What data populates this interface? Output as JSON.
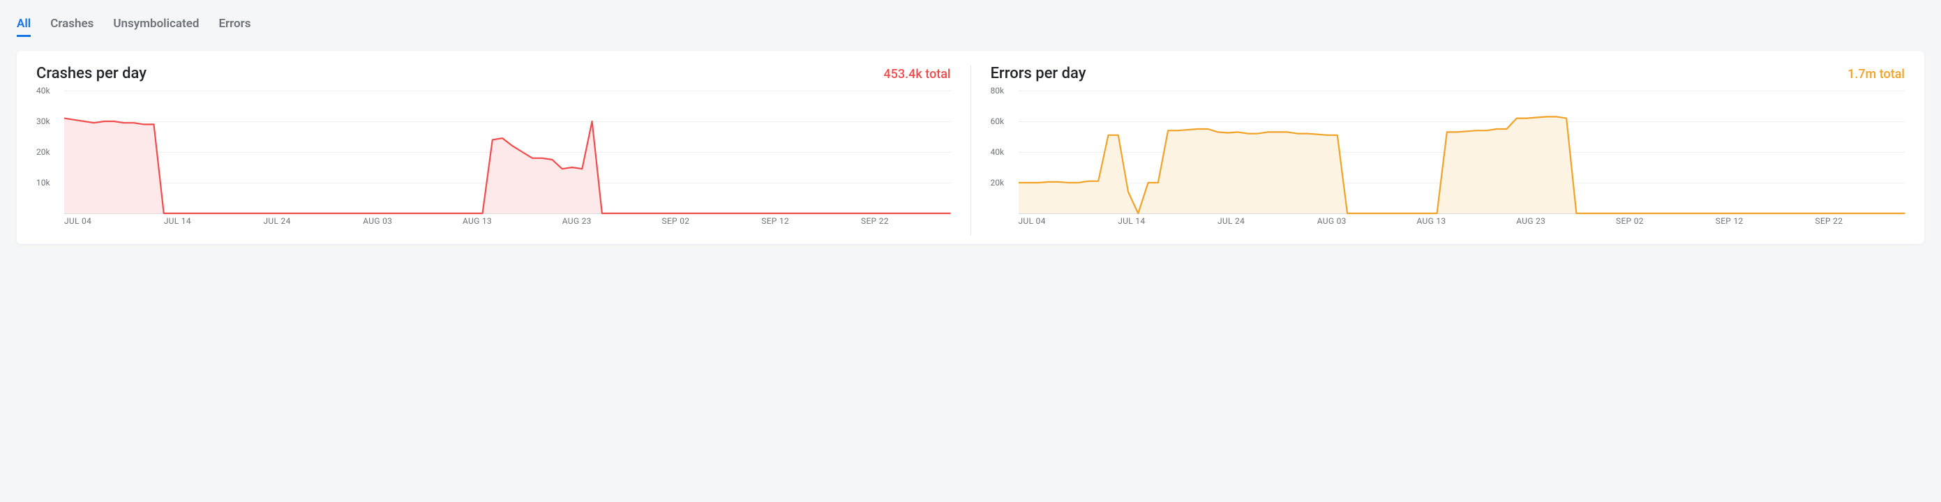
{
  "tabs": {
    "items": [
      {
        "label": "All",
        "active": true
      },
      {
        "label": "Crashes",
        "active": false
      },
      {
        "label": "Unsymbolicated",
        "active": false
      },
      {
        "label": "Errors",
        "active": false
      }
    ]
  },
  "panels": [
    {
      "id": "crashes",
      "title": "Crashes per day",
      "total_label": "453.4k total",
      "accent": "#f14c4c",
      "fill": "#fde9e9",
      "y_ticks": [
        {
          "label": "40k",
          "value": 40000
        },
        {
          "label": "30k",
          "value": 30000
        },
        {
          "label": "20k",
          "value": 20000
        },
        {
          "label": "10k",
          "value": 10000
        }
      ],
      "y_max": 40000,
      "x_ticks": [
        "JUL 04",
        "JUL 14",
        "JUL 24",
        "AUG 03",
        "AUG 13",
        "AUG 23",
        "SEP 02",
        "SEP 12",
        "SEP 22"
      ]
    },
    {
      "id": "errors",
      "title": "Errors per day",
      "total_label": "1.7m total",
      "accent": "#f0a229",
      "fill": "#fdf3e3",
      "y_ticks": [
        {
          "label": "80k",
          "value": 80000
        },
        {
          "label": "60k",
          "value": 60000
        },
        {
          "label": "40k",
          "value": 40000
        },
        {
          "label": "20k",
          "value": 20000
        }
      ],
      "y_max": 80000,
      "x_ticks": [
        "JUL 04",
        "JUL 14",
        "JUL 24",
        "AUG 03",
        "AUG 13",
        "AUG 23",
        "SEP 02",
        "SEP 12",
        "SEP 22"
      ]
    }
  ],
  "chart_data": [
    {
      "type": "area",
      "title": "Crashes per day",
      "xlabel": "",
      "ylabel": "",
      "ylim": [
        0,
        40000
      ],
      "x_tick_labels": [
        "JUL 04",
        "JUL 14",
        "JUL 24",
        "AUG 03",
        "AUG 13",
        "AUG 23",
        "SEP 02",
        "SEP 12",
        "SEP 22"
      ],
      "series": [
        {
          "name": "Crashes",
          "color": "#f14c4c",
          "x": [
            0,
            1,
            2,
            3,
            4,
            5,
            6,
            7,
            8,
            9,
            10,
            11,
            12,
            41,
            42,
            43,
            44,
            45,
            46,
            47,
            48,
            49,
            50,
            51,
            52,
            53,
            54,
            55,
            56,
            57,
            58,
            59,
            60,
            89
          ],
          "values": [
            31000,
            30500,
            30000,
            29500,
            30000,
            30000,
            29500,
            29500,
            29000,
            29000,
            0,
            0,
            0,
            0,
            0,
            24000,
            24500,
            22000,
            20000,
            18000,
            18000,
            17500,
            14500,
            15000,
            14500,
            30000,
            0,
            0,
            0,
            0,
            0,
            0,
            0,
            0
          ]
        }
      ],
      "x_range": [
        0,
        89
      ]
    },
    {
      "type": "area",
      "title": "Errors per day",
      "xlabel": "",
      "ylabel": "",
      "ylim": [
        0,
        80000
      ],
      "x_tick_labels": [
        "JUL 04",
        "JUL 14",
        "JUL 24",
        "AUG 03",
        "AUG 13",
        "AUG 23",
        "SEP 02",
        "SEP 12",
        "SEP 22"
      ],
      "series": [
        {
          "name": "Errors",
          "color": "#f0a229",
          "x": [
            0,
            1,
            2,
            3,
            4,
            5,
            6,
            7,
            8,
            9,
            10,
            11,
            12,
            13,
            14,
            15,
            16,
            17,
            18,
            19,
            20,
            21,
            22,
            23,
            24,
            25,
            26,
            27,
            28,
            29,
            30,
            31,
            32,
            33,
            34,
            41,
            42,
            43,
            44,
            45,
            46,
            47,
            48,
            49,
            50,
            51,
            52,
            53,
            54,
            55,
            56,
            57,
            58,
            89
          ],
          "values": [
            20000,
            20000,
            20000,
            20500,
            20500,
            20000,
            20000,
            21000,
            21000,
            51000,
            51000,
            14000,
            0,
            20000,
            20000,
            54000,
            54000,
            54500,
            55000,
            55000,
            53000,
            52500,
            53000,
            52000,
            52000,
            53000,
            53000,
            53000,
            52000,
            52000,
            51500,
            51000,
            51000,
            0,
            0,
            0,
            0,
            53000,
            53000,
            53500,
            54000,
            54000,
            55000,
            55000,
            62000,
            62000,
            62500,
            63000,
            63000,
            62000,
            0,
            0,
            0,
            0
          ]
        }
      ],
      "x_range": [
        0,
        89
      ]
    }
  ]
}
